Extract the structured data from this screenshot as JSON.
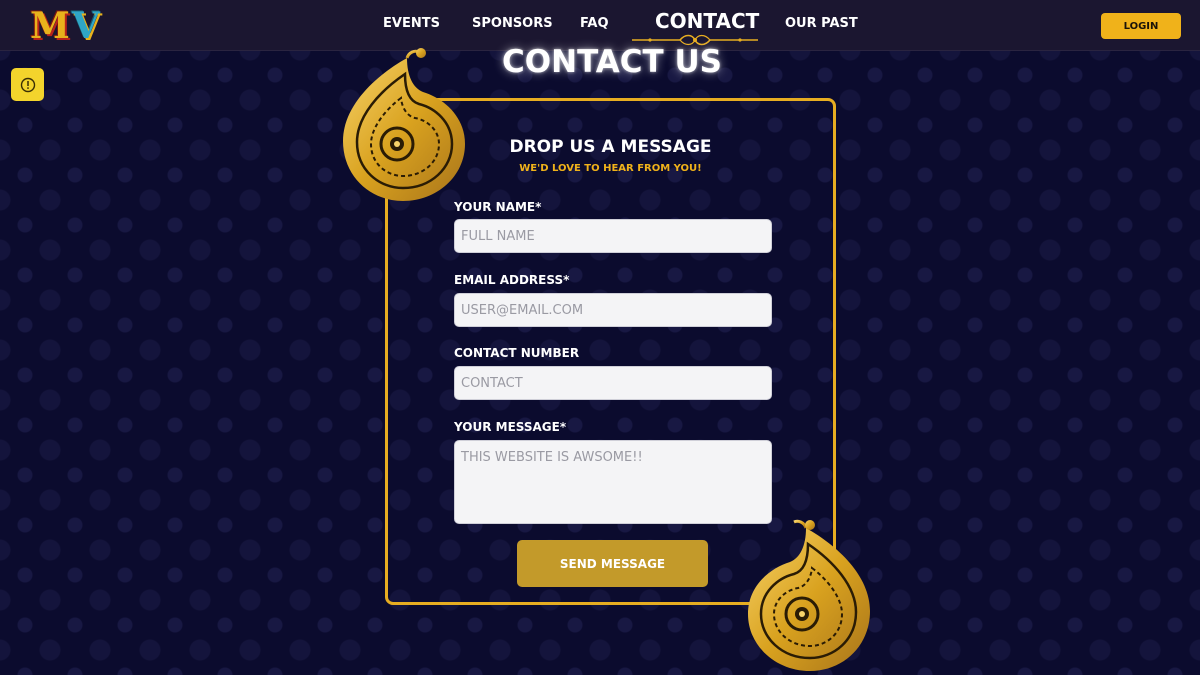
{
  "brand": {
    "logo_left": "M",
    "logo_right": "V"
  },
  "nav": {
    "items": [
      {
        "label": "EVENTS"
      },
      {
        "label": "SPONSORS"
      },
      {
        "label": "FAQ"
      },
      {
        "label": "CONTACT",
        "active": true
      },
      {
        "label": "OUR PAST"
      }
    ],
    "login_label": "LOGIN"
  },
  "page": {
    "title": "CONTACT US"
  },
  "form": {
    "heading": "DROP US A MESSAGE",
    "subheading": "WE'D LOVE TO HEAR FROM YOU!",
    "fields": [
      {
        "label": "YOUR NAME*",
        "placeholder": "FULL NAME",
        "value": ""
      },
      {
        "label": "EMAIL ADDRESS*",
        "placeholder": "USER@EMAIL.COM",
        "value": ""
      },
      {
        "label": "CONTACT NUMBER",
        "placeholder": "CONTACT",
        "value": ""
      },
      {
        "label": "YOUR MESSAGE*",
        "placeholder": "THIS WEBSITE IS AWSOME!!",
        "value": ""
      }
    ],
    "submit_label": "SEND MESSAGE"
  },
  "icons": {
    "alert": "alert-circle-icon",
    "paisley": "paisley-ornament-icon"
  },
  "colors": {
    "background": "#0b0b2e",
    "navbar": "#1b1630",
    "accent_gold": "#e7ad21",
    "login_button": "#f0b21a",
    "send_button": "#c39a2a",
    "alert_button": "#f3d42c",
    "subheading": "#f0b21a"
  }
}
